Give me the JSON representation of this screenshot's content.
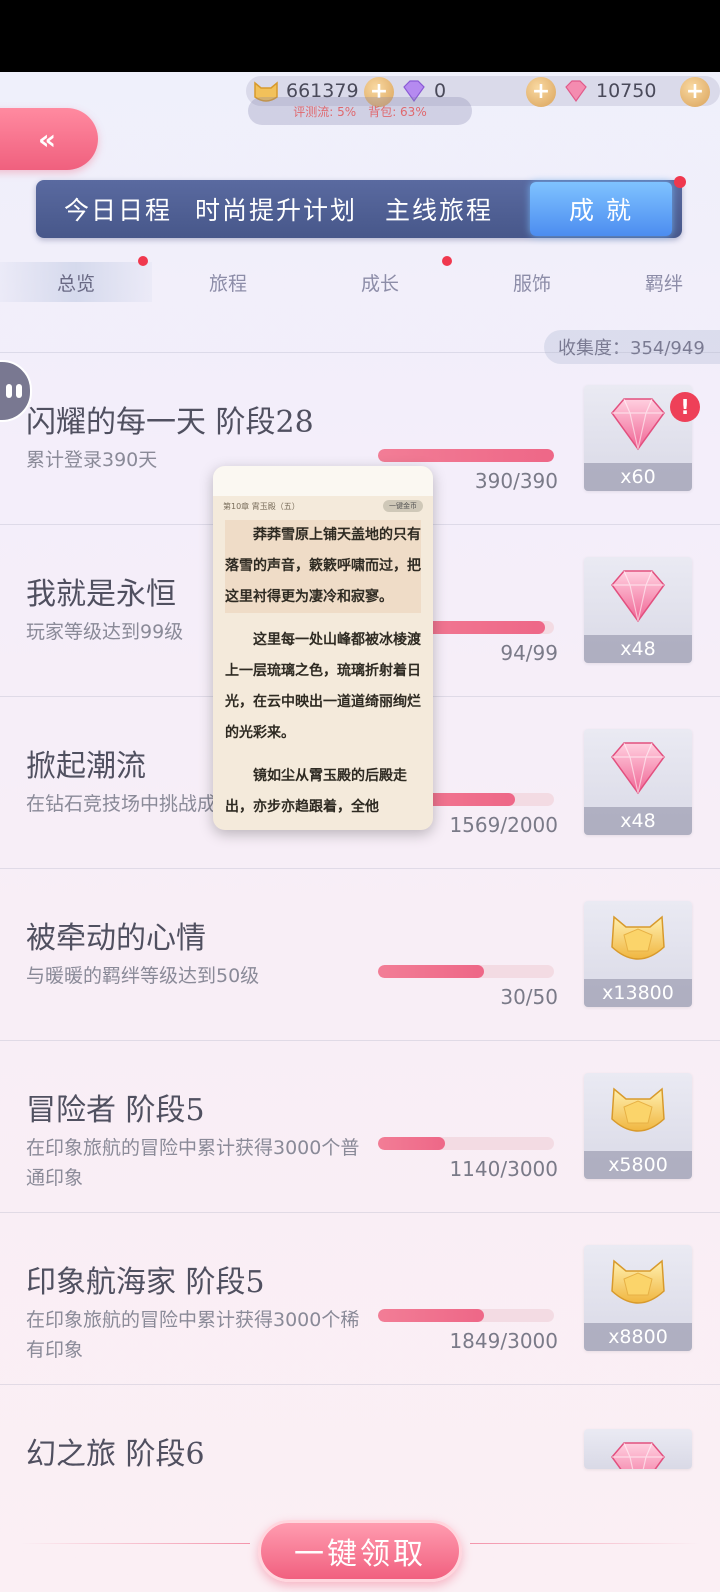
{
  "currency": {
    "gold": "661379",
    "diamond": "0",
    "crystal": "10750",
    "overlay_left": "评测流: 5%",
    "overlay_right": "背包: 63%",
    "plus_label": "+"
  },
  "back_label": "«",
  "main_tabs": [
    {
      "label": "今日日程"
    },
    {
      "label": "时尚提升计划"
    },
    {
      "label": "主线旅程"
    },
    {
      "label": "成 就"
    }
  ],
  "sub_tabs": [
    {
      "label": "总览"
    },
    {
      "label": "旅程"
    },
    {
      "label": "成长"
    },
    {
      "label": "服饰"
    },
    {
      "label": "羁绊"
    }
  ],
  "collection": "收集度：354/949",
  "alert": "!",
  "achievements": [
    {
      "title": "闪耀的每一天 阶段28",
      "desc": "累计登录390天",
      "count": "390/390",
      "progress": 1.0,
      "reward": "x60",
      "reward_type": "pink-diamond"
    },
    {
      "title": "我就是永恒",
      "desc": "玩家等级达到99级",
      "count": "94/99",
      "progress": 0.95,
      "reward": "x48",
      "reward_type": "pink-diamond"
    },
    {
      "title": "掀起潮流",
      "desc": "在钻石竞技场中挑战成功",
      "count": "1569/2000",
      "progress": 0.78,
      "reward": "x48",
      "reward_type": "pink-diamond"
    },
    {
      "title": "被牵动的心情",
      "desc": "与暖暖的羁绊等级达到50级",
      "count": "30/50",
      "progress": 0.6,
      "reward": "x13800",
      "reward_type": "gold-coin"
    },
    {
      "title": "冒险者 阶段5",
      "desc": "在印象旅航的冒险中累计获得3000个普通印象",
      "count": "1140/3000",
      "progress": 0.38,
      "reward": "x5800",
      "reward_type": "gold-coin"
    },
    {
      "title": "印象航海家 阶段5",
      "desc": "在印象旅航的冒险中累计获得3000个稀有印象",
      "count": "1849/3000",
      "progress": 0.6,
      "reward": "x8800",
      "reward_type": "gold-coin"
    },
    {
      "title": "幻之旅 阶段6",
      "desc": "",
      "count": "",
      "progress": 0,
      "reward": "",
      "reward_type": "pink-diamond"
    }
  ],
  "reader": {
    "chapter": "第10章 霄玉殿（五）",
    "chip": "一键金币",
    "p1": "莽莽雪原上铺天盖地的只有落雪的声音，簌簌呼啸而过，把这里衬得更为凄冷和寂寥。",
    "p2": "这里每一处山峰都被冰棱渡上一层琉璃之色，琉璃折射着日光，在云中映出一道道绮丽绚烂的光彩来。",
    "p3": "镜如尘从霄玉殿的后殿走出，亦步亦趋跟着，全他"
  },
  "claim_label": "一键领取",
  "colors": {
    "accent_pink": "#ee6787",
    "tab_blue": "#4c8df0",
    "tab_bar": "#47578a"
  }
}
